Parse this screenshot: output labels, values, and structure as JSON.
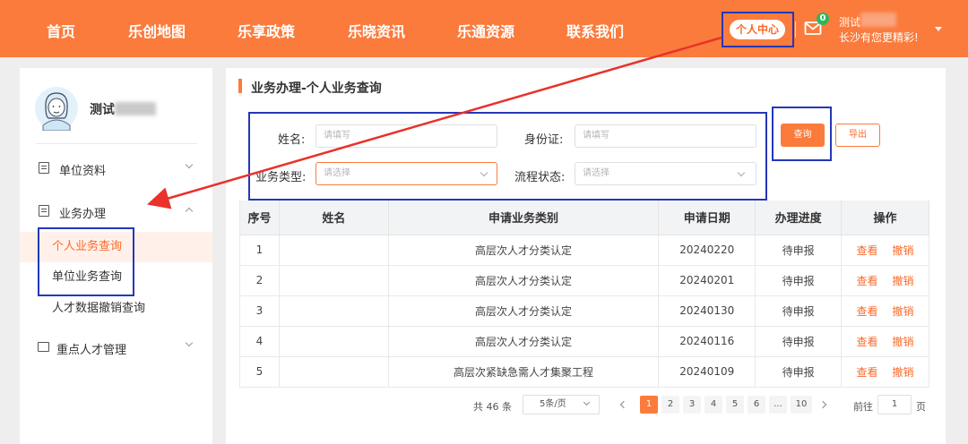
{
  "nav": {
    "items": [
      "首页",
      "乐创地图",
      "乐享政策",
      "乐晓资讯",
      "乐通资源",
      "联系我们"
    ],
    "personal_center": "个人中心",
    "mail_count": "0",
    "user_name": "测试",
    "user_slogan": "长沙有您更精彩!",
    "brand_color": "#fb7b3c"
  },
  "sidebar": {
    "profile_name": "测试",
    "groups": [
      {
        "label": "单位资料",
        "icon": "document-icon"
      },
      {
        "label": "业务办理",
        "icon": "list-icon"
      },
      {
        "label": "重点人才管理",
        "icon": "folder-icon"
      }
    ],
    "sub_items": [
      "个人业务查询",
      "单位业务查询",
      "人才数据撤销查询"
    ],
    "active_item": "个人业务查询"
  },
  "main": {
    "title": "业务办理-个人业务查询",
    "form": {
      "name_label": "姓名:",
      "name_placeholder": "请填写",
      "id_label": "身份证:",
      "id_placeholder": "请填写",
      "type_label": "业务类型:",
      "type_placeholder": "请选择",
      "status_label": "流程状态:",
      "status_placeholder": "请选择"
    },
    "buttons": {
      "query": "查询",
      "export": "导出"
    },
    "table": {
      "headers": [
        "序号",
        "姓名",
        "申请业务类别",
        "申请日期",
        "办理进度",
        "操作"
      ],
      "rows": [
        {
          "no": "1",
          "name": "",
          "category": "高层次人才分类认定",
          "date": "20240220",
          "progress": "待申报"
        },
        {
          "no": "2",
          "name": "",
          "category": "高层次人才分类认定",
          "date": "20240201",
          "progress": "待申报"
        },
        {
          "no": "3",
          "name": "",
          "category": "高层次人才分类认定",
          "date": "20240130",
          "progress": "待申报"
        },
        {
          "no": "4",
          "name": "",
          "category": "高层次人才分类认定",
          "date": "20240116",
          "progress": "待申报"
        },
        {
          "no": "5",
          "name": "",
          "category": "高层次紧缺急需人才集聚工程",
          "date": "20240109",
          "progress": "待申报"
        }
      ],
      "view_label": "查看",
      "revoke_label": "撤销"
    },
    "pagination": {
      "total": "共 46 条",
      "page_size": "5条/页",
      "pages": [
        "1",
        "2",
        "3",
        "4",
        "5",
        "6",
        "...",
        "10"
      ],
      "current": "1",
      "goto_prefix": "前往",
      "goto_value": "1",
      "goto_suffix": "页"
    }
  },
  "annotation_color": "#2437b8",
  "arrow_color": "#e8322b"
}
